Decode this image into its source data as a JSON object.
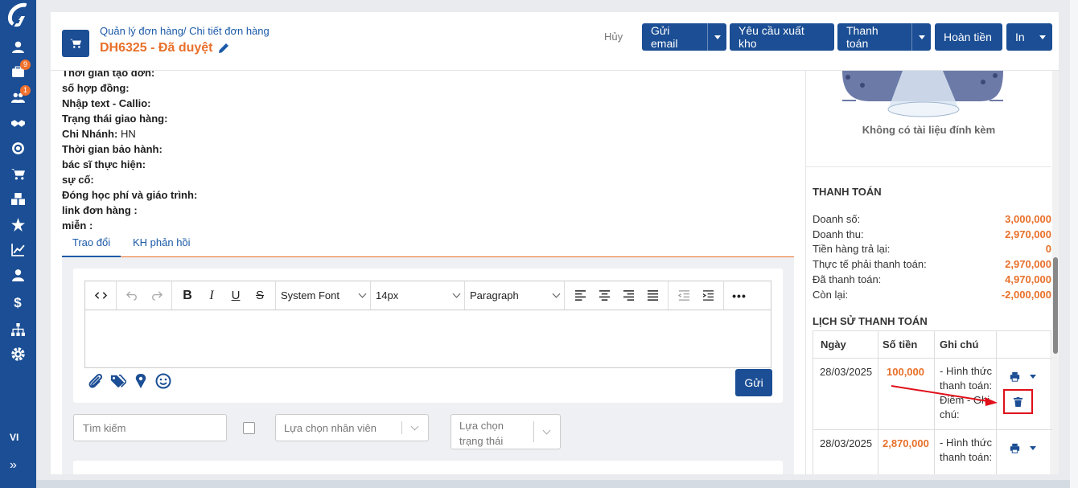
{
  "sidebar": {
    "logo": "logo-icon",
    "items": [
      {
        "icon": "user-icon",
        "badge": ""
      },
      {
        "icon": "briefcase-icon",
        "badge": "9"
      },
      {
        "icon": "users-icon",
        "badge": "1"
      },
      {
        "icon": "handshake-icon",
        "badge": ""
      },
      {
        "icon": "target-icon",
        "badge": ""
      },
      {
        "icon": "cart-icon",
        "badge": ""
      },
      {
        "icon": "boxes-icon",
        "badge": ""
      },
      {
        "icon": "star-icon",
        "badge": ""
      },
      {
        "icon": "chart-icon",
        "badge": ""
      },
      {
        "icon": "user-tie-icon",
        "badge": ""
      },
      {
        "icon": "dollar-icon",
        "badge": ""
      },
      {
        "icon": "sitemap-icon",
        "badge": ""
      },
      {
        "icon": "gear-icon",
        "badge": ""
      }
    ],
    "language": "VI",
    "expand": "»"
  },
  "header": {
    "breadcrumb": "Quản lý đơn hàng/ Chi tiết đơn hàng",
    "order_title": "DH6325 - Đã duyệt",
    "cancel": "Hủy",
    "buttons": {
      "email": "Gửi email",
      "export": "Yêu cầu xuất kho",
      "payment": "Thanh toán",
      "refund": "Hoàn tiền",
      "print": "In"
    }
  },
  "info": [
    {
      "label": "Thời gian tạo đơn:",
      "value": ""
    },
    {
      "label": "số hợp đồng:",
      "value": ""
    },
    {
      "label": "Nhập text - Callio:",
      "value": ""
    },
    {
      "label": "Trạng thái giao hàng:",
      "value": ""
    },
    {
      "label": "Chi Nhánh:",
      "value": " HN"
    },
    {
      "label": "Thời gian bảo hành:",
      "value": ""
    },
    {
      "label": "bác sĩ thực hiện:",
      "value": ""
    },
    {
      "label": "sự cố:",
      "value": ""
    },
    {
      "label": "Đóng học phí và giáo trình:",
      "value": ""
    },
    {
      "label": "link đơn hàng :",
      "value": ""
    },
    {
      "label": "miễn :",
      "value": ""
    }
  ],
  "tabs": {
    "active": "Trao đổi",
    "other": "KH phản hồi"
  },
  "editor": {
    "font": "System Font",
    "size": "14px",
    "block": "Paragraph",
    "send": "Gửi"
  },
  "filters": {
    "search_placeholder": "Tìm kiếm",
    "employee_placeholder": "Lựa chọn nhân viên",
    "status_line1": "Lựa chọn",
    "status_line2": "trạng thái"
  },
  "right": {
    "no_attachment": "Không có tài liệu đính kèm",
    "payment_title": "THANH TOÁN",
    "payment_rows": [
      {
        "label": "Doanh số:",
        "value": "3,000,000"
      },
      {
        "label": "Doanh thu:",
        "value": "2,970,000"
      },
      {
        "label": "Tiền hàng trả lại:",
        "value": "0"
      },
      {
        "label": "Thực tế phải thanh toán:",
        "value": "2,970,000"
      },
      {
        "label": "Đã thanh toán:",
        "value": "4,970,000"
      },
      {
        "label": "Còn lại:",
        "value": "-2,000,000"
      }
    ],
    "history_title": "LỊCH SỬ THANH TOÁN",
    "history_headers": {
      "date": "Ngày",
      "amount": "Số tiền",
      "note": "Ghi chú"
    },
    "history_rows": [
      {
        "date": "28/03/2025",
        "amount": "100,000",
        "note": "- Hình thức thanh toán: Điểm - Ghi chú:"
      },
      {
        "date": "28/03/2025",
        "amount": "2,870,000",
        "note": "- Hình thức thanh toán:"
      }
    ]
  },
  "colors": {
    "brand": "#1b4e94",
    "accent": "#e8702a",
    "highlight": "#e0101a"
  }
}
